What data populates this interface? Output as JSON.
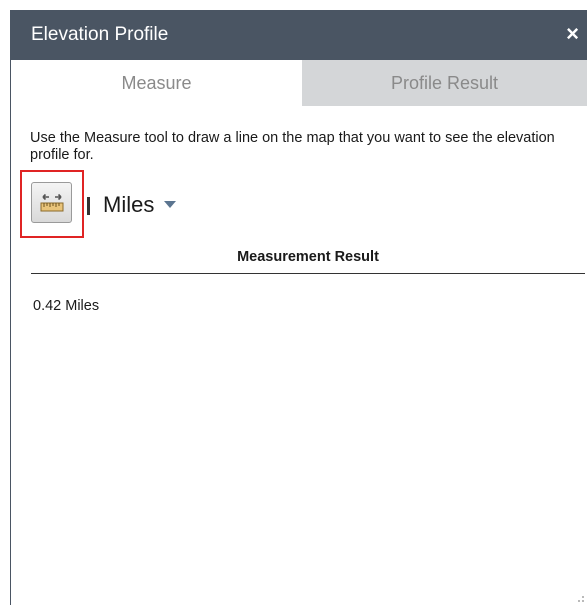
{
  "panel": {
    "title": "Elevation Profile",
    "close_glyph": "×",
    "colors": {
      "titlebar": "#4a5563",
      "active_tab": "#ffffff",
      "inactive_tab": "#d4d6d8",
      "highlight": "#e02424"
    }
  },
  "tabs": [
    {
      "label": "Measure",
      "active": true
    },
    {
      "label": "Profile Result",
      "active": false
    }
  ],
  "measure": {
    "instructions": "Use the Measure tool to draw a line on the map that you want to see the elevation profile for.",
    "tool_icon": "ruler-distance-icon",
    "unit": "Miles"
  },
  "result": {
    "header": "Measurement Result",
    "value": "0.42 Miles"
  }
}
